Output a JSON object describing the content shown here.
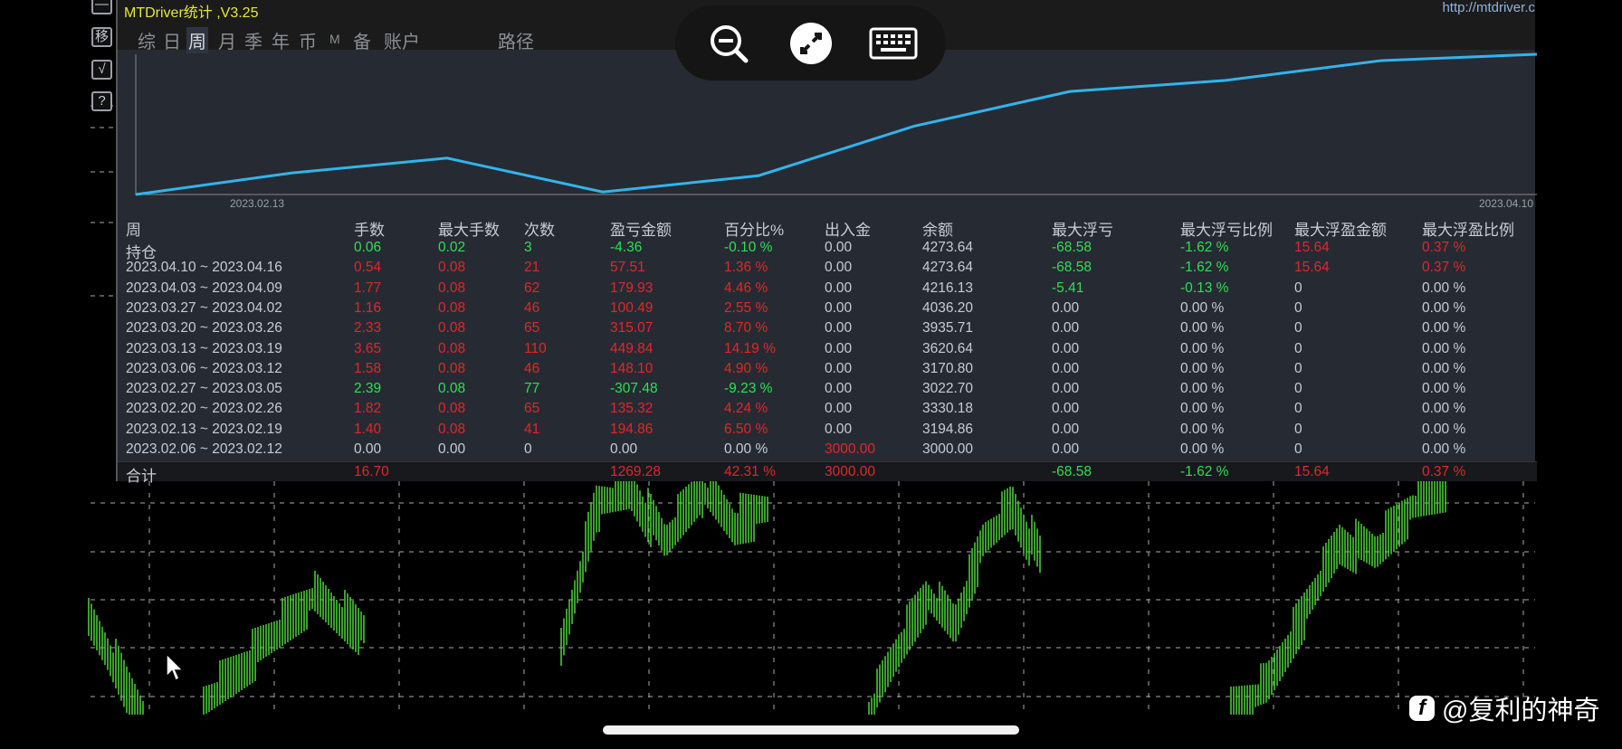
{
  "app": {
    "title": "MTDriver统计 ,V3.25",
    "site": "http://mtdriver.c"
  },
  "side_buttons": [
    "—",
    "移",
    "√",
    "?"
  ],
  "tabs": [
    {
      "label": "综"
    },
    {
      "label": "日"
    },
    {
      "label": "周",
      "active": true
    },
    {
      "label": "月"
    },
    {
      "label": "季"
    },
    {
      "label": "年"
    },
    {
      "label": "币"
    },
    {
      "label": "M"
    },
    {
      "label": "备"
    },
    {
      "label": "账户"
    },
    {
      "label": "路径"
    }
  ],
  "chart": {
    "start_label": "2023.02.13",
    "end_label": "2023.04.10",
    "line_color": "#31b4ec"
  },
  "table": {
    "headers": [
      "周",
      "手数",
      "最大手数",
      "次数",
      "盈亏金额",
      "百分比%",
      "出入金",
      "余额",
      "最大浮亏",
      "最大浮亏比例",
      "最大浮盈金额",
      "最大浮盈比例"
    ],
    "rows": [
      {
        "label": "持仓",
        "cells": [
          [
            "0.06",
            "g"
          ],
          [
            "0.02",
            "g"
          ],
          [
            "3",
            "g"
          ],
          [
            "-4.36",
            "g"
          ],
          [
            "-0.10 %",
            "g"
          ],
          [
            "0.00",
            "w"
          ],
          [
            "4273.64",
            "w"
          ],
          [
            "-68.58",
            "g"
          ],
          [
            "-1.62 %",
            "g"
          ],
          [
            "15.64",
            "r"
          ],
          [
            "0.37 %",
            "r"
          ]
        ]
      },
      {
        "label": "2023.04.10 ~ 2023.04.16",
        "cells": [
          [
            "0.54",
            "r"
          ],
          [
            "0.08",
            "r"
          ],
          [
            "21",
            "r"
          ],
          [
            "57.51",
            "r"
          ],
          [
            "1.36 %",
            "r"
          ],
          [
            "0.00",
            "w"
          ],
          [
            "4273.64",
            "w"
          ],
          [
            "-68.58",
            "g"
          ],
          [
            "-1.62 %",
            "g"
          ],
          [
            "15.64",
            "r"
          ],
          [
            "0.37 %",
            "r"
          ]
        ]
      },
      {
        "label": "2023.04.03 ~ 2023.04.09",
        "cells": [
          [
            "1.77",
            "r"
          ],
          [
            "0.08",
            "r"
          ],
          [
            "62",
            "r"
          ],
          [
            "179.93",
            "r"
          ],
          [
            "4.46 %",
            "r"
          ],
          [
            "0.00",
            "w"
          ],
          [
            "4216.13",
            "w"
          ],
          [
            "-5.41",
            "g"
          ],
          [
            "-0.13 %",
            "g"
          ],
          [
            "0",
            "w"
          ],
          [
            "0.00 %",
            "w"
          ]
        ]
      },
      {
        "label": "2023.03.27 ~ 2023.04.02",
        "cells": [
          [
            "1.16",
            "r"
          ],
          [
            "0.08",
            "r"
          ],
          [
            "46",
            "r"
          ],
          [
            "100.49",
            "r"
          ],
          [
            "2.55 %",
            "r"
          ],
          [
            "0.00",
            "w"
          ],
          [
            "4036.20",
            "w"
          ],
          [
            "0.00",
            "w"
          ],
          [
            "0.00 %",
            "w"
          ],
          [
            "0",
            "w"
          ],
          [
            "0.00 %",
            "w"
          ]
        ]
      },
      {
        "label": "2023.03.20 ~ 2023.03.26",
        "cells": [
          [
            "2.33",
            "r"
          ],
          [
            "0.08",
            "r"
          ],
          [
            "65",
            "r"
          ],
          [
            "315.07",
            "r"
          ],
          [
            "8.70 %",
            "r"
          ],
          [
            "0.00",
            "w"
          ],
          [
            "3935.71",
            "w"
          ],
          [
            "0.00",
            "w"
          ],
          [
            "0.00 %",
            "w"
          ],
          [
            "0",
            "w"
          ],
          [
            "0.00 %",
            "w"
          ]
        ]
      },
      {
        "label": "2023.03.13 ~ 2023.03.19",
        "cells": [
          [
            "3.65",
            "r"
          ],
          [
            "0.08",
            "r"
          ],
          [
            "110",
            "r"
          ],
          [
            "449.84",
            "r"
          ],
          [
            "14.19 %",
            "r"
          ],
          [
            "0.00",
            "w"
          ],
          [
            "3620.64",
            "w"
          ],
          [
            "0.00",
            "w"
          ],
          [
            "0.00 %",
            "w"
          ],
          [
            "0",
            "w"
          ],
          [
            "0.00 %",
            "w"
          ]
        ]
      },
      {
        "label": "2023.03.06 ~ 2023.03.12",
        "cells": [
          [
            "1.58",
            "r"
          ],
          [
            "0.08",
            "r"
          ],
          [
            "46",
            "r"
          ],
          [
            "148.10",
            "r"
          ],
          [
            "4.90 %",
            "r"
          ],
          [
            "0.00",
            "w"
          ],
          [
            "3170.80",
            "w"
          ],
          [
            "0.00",
            "w"
          ],
          [
            "0.00 %",
            "w"
          ],
          [
            "0",
            "w"
          ],
          [
            "0.00 %",
            "w"
          ]
        ]
      },
      {
        "label": "2023.02.27 ~ 2023.03.05",
        "cells": [
          [
            "2.39",
            "g"
          ],
          [
            "0.08",
            "g"
          ],
          [
            "77",
            "g"
          ],
          [
            "-307.48",
            "g"
          ],
          [
            "-9.23 %",
            "g"
          ],
          [
            "0.00",
            "w"
          ],
          [
            "3022.70",
            "w"
          ],
          [
            "0.00",
            "w"
          ],
          [
            "0.00 %",
            "w"
          ],
          [
            "0",
            "w"
          ],
          [
            "0.00 %",
            "w"
          ]
        ]
      },
      {
        "label": "2023.02.20 ~ 2023.02.26",
        "cells": [
          [
            "1.82",
            "r"
          ],
          [
            "0.08",
            "r"
          ],
          [
            "65",
            "r"
          ],
          [
            "135.32",
            "r"
          ],
          [
            "4.24 %",
            "r"
          ],
          [
            "0.00",
            "w"
          ],
          [
            "3330.18",
            "w"
          ],
          [
            "0.00",
            "w"
          ],
          [
            "0.00 %",
            "w"
          ],
          [
            "0",
            "w"
          ],
          [
            "0.00 %",
            "w"
          ]
        ]
      },
      {
        "label": "2023.02.13 ~ 2023.02.19",
        "cells": [
          [
            "1.40",
            "r"
          ],
          [
            "0.08",
            "r"
          ],
          [
            "41",
            "r"
          ],
          [
            "194.86",
            "r"
          ],
          [
            "6.50 %",
            "r"
          ],
          [
            "0.00",
            "w"
          ],
          [
            "3194.86",
            "w"
          ],
          [
            "0.00",
            "w"
          ],
          [
            "0.00 %",
            "w"
          ],
          [
            "0",
            "w"
          ],
          [
            "0.00 %",
            "w"
          ]
        ]
      },
      {
        "label": "2023.02.06 ~ 2023.02.12",
        "cells": [
          [
            "0.00",
            "w"
          ],
          [
            "0.00",
            "w"
          ],
          [
            "0",
            "w"
          ],
          [
            "0.00",
            "w"
          ],
          [
            "0.00 %",
            "w"
          ],
          [
            "3000.00",
            "r"
          ],
          [
            "3000.00",
            "w"
          ],
          [
            "0.00",
            "w"
          ],
          [
            "0.00 %",
            "w"
          ],
          [
            "0",
            "w"
          ],
          [
            "0.00 %",
            "w"
          ]
        ]
      }
    ],
    "total": {
      "label": "合计",
      "cells": [
        [
          "16.70",
          "r"
        ],
        [
          "",
          "w"
        ],
        [
          "",
          "w"
        ],
        [
          "1269.28",
          "r"
        ],
        [
          "42.31 %",
          "r"
        ],
        [
          "3000.00",
          "r"
        ],
        [
          "",
          "w"
        ],
        [
          "-68.58",
          "g"
        ],
        [
          "-1.62 %",
          "g"
        ],
        [
          "15.64",
          "r"
        ],
        [
          "0.37 %",
          "r"
        ]
      ]
    }
  },
  "toolbar": {
    "icons": [
      "zoom-out-icon",
      "remote-connect-icon",
      "keyboard-icon"
    ]
  },
  "watermark": {
    "text": "@复利的神奇"
  }
}
